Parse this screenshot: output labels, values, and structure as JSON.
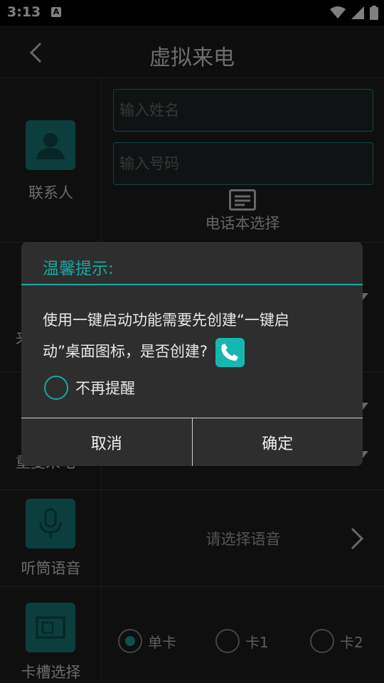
{
  "status": {
    "time": "3:13",
    "notif": "A"
  },
  "header": {
    "title": "虚拟来电"
  },
  "contact": {
    "label": "联系人",
    "name_placeholder": "输入姓名",
    "number_placeholder": "输入号码",
    "phonebook_label": "电话本选择"
  },
  "hidden_rows": {
    "row2_label_fragment": "来",
    "row3_label_fragment": "重复来电"
  },
  "voice": {
    "label": "听筒语音",
    "select_label": "请选择语音"
  },
  "sim": {
    "label": "卡槽选择",
    "options": [
      "单卡",
      "卡1",
      "卡2"
    ],
    "selected": "单卡"
  },
  "dialog": {
    "title": "温馨提示:",
    "message_part1": "使用一键启动功能需要先创建“一键启",
    "message_part2": "动”桌面图标，是否创建?",
    "checkbox_label": "不再提醒",
    "cancel_label": "取消",
    "confirm_label": "确定"
  },
  "colors": {
    "accent": "#1aa8a3",
    "icon_bg": "#167c7a",
    "background": "#1e1e1e"
  }
}
